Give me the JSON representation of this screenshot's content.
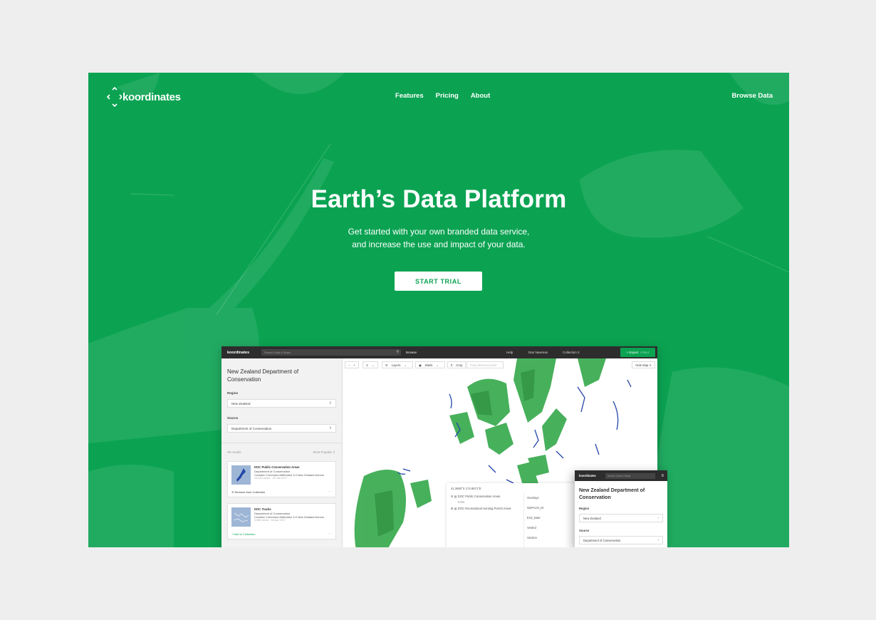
{
  "nav": {
    "logo": "koordinates",
    "links": [
      "Features",
      "Pricing",
      "About"
    ],
    "browse": "Browse Data"
  },
  "hero": {
    "title": "Earth’s Data Platform",
    "subtitle_line1": "Get started with your own branded data service,",
    "subtitle_line2": "and increase the use and impact of your data.",
    "cta": "START TRIAL"
  },
  "app": {
    "logo": "koordinates",
    "search_placeholder": "Search Data & Maps",
    "browse": "Browse",
    "help": "Help",
    "user": "Dan Newman",
    "collection": "Collection",
    "collection_count": "2",
    "export": "Export",
    "export_shortcut": "CTRL E",
    "sidebar": {
      "title": "New Zealand Department of Conservation",
      "region_label": "Region",
      "region_value": "New Zealand",
      "source_label": "Source",
      "source_value": "Department of Conservation",
      "results": "29 results",
      "sort": "Most Popular",
      "cards": [
        {
          "title": "DOC Public Conservation Areas",
          "publisher": "Department of Conservation",
          "license": "Creative Commons Attribution 3.0 New Zealand licence",
          "meta": "10,032 views · 23 Jan 2017",
          "action": "Remove from Collection"
        },
        {
          "title": "DOC Tracks",
          "publisher": "Department of Conservation",
          "license": "Creative Commons Attribution 3.0 New Zealand licence",
          "meta": "3,586 views · 18 Apr 2017",
          "action": "Add to Collection"
        }
      ]
    },
    "toolbar": {
      "layers": "Layers",
      "blank": "Blank",
      "crop": "Crop",
      "location_placeholder": "Find reference point",
      "hide_map": "Hide Map"
    },
    "info": {
      "coords": "41.2660°S 174.9671°E",
      "layer1": "DOC Public Conservation Areas",
      "layer1_sub": "0.0m",
      "layer2": "DOC Recreational Hunting Permit Areas",
      "fields": [
        "Overlays",
        "NaPALIS_ID",
        "End_Date",
        "Vested",
        "Section"
      ]
    },
    "mobile": {
      "logo": "koordinates",
      "search_placeholder": "Search Data & Maps",
      "title": "New Zealand Department of Conservation",
      "region_label": "Region",
      "region_value": "New Zealand",
      "source_label": "Source",
      "source_value": "Department of Conservation"
    }
  },
  "colors": {
    "brand_green": "#0ba352",
    "page_bg": "#eeeeee",
    "dark_bar": "#2d2d2d"
  }
}
